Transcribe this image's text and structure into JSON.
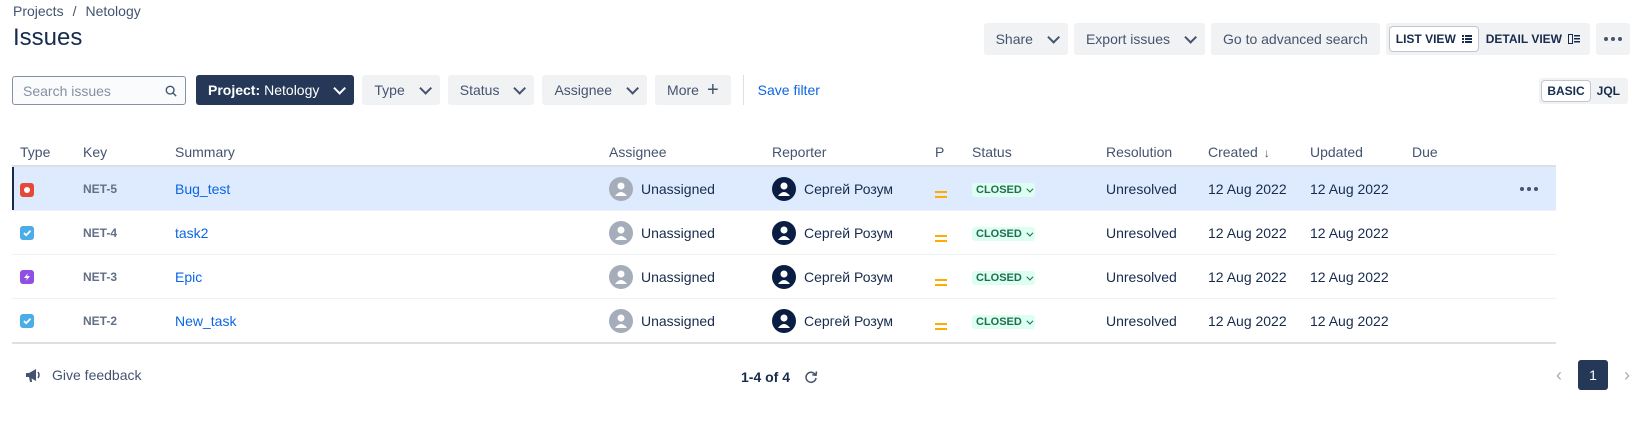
{
  "breadcrumb": {
    "projects": "Projects",
    "separator": "/",
    "project": "Netology"
  },
  "page_title": "Issues",
  "toolbar": {
    "share": "Share",
    "export": "Export issues",
    "advanced_search": "Go to advanced search",
    "list_view": "LIST VIEW",
    "detail_view": "DETAIL VIEW"
  },
  "search": {
    "placeholder": "Search issues"
  },
  "filters": {
    "project_label": "Project:",
    "project_value": "Netology",
    "type": "Type",
    "status": "Status",
    "assignee": "Assignee",
    "more": "More",
    "save_filter": "Save filter"
  },
  "mode": {
    "basic": "BASIC",
    "jql": "JQL"
  },
  "columns": {
    "type": "Type",
    "key": "Key",
    "summary": "Summary",
    "assignee": "Assignee",
    "reporter": "Reporter",
    "priority": "P",
    "status": "Status",
    "resolution": "Resolution",
    "created": "Created",
    "updated": "Updated",
    "due": "Due"
  },
  "rows": [
    {
      "type": "bug",
      "key": "NET-5",
      "summary": "Bug_test",
      "assignee": "Unassigned",
      "reporter": "Сергей Розум",
      "status": "CLOSED",
      "resolution": "Unresolved",
      "created": "12 Aug 2022",
      "updated": "12 Aug 2022",
      "due": ""
    },
    {
      "type": "task",
      "key": "NET-4",
      "summary": "task2",
      "assignee": "Unassigned",
      "reporter": "Сергей Розум",
      "status": "CLOSED",
      "resolution": "Unresolved",
      "created": "12 Aug 2022",
      "updated": "12 Aug 2022",
      "due": ""
    },
    {
      "type": "epic",
      "key": "NET-3",
      "summary": "Epic",
      "assignee": "Unassigned",
      "reporter": "Сергей Розум",
      "status": "CLOSED",
      "resolution": "Unresolved",
      "created": "12 Aug 2022",
      "updated": "12 Aug 2022",
      "due": ""
    },
    {
      "type": "task",
      "key": "NET-2",
      "summary": "New_task",
      "assignee": "Unassigned",
      "reporter": "Сергей Розум",
      "status": "CLOSED",
      "resolution": "Unresolved",
      "created": "12 Aug 2022",
      "updated": "12 Aug 2022",
      "due": ""
    }
  ],
  "footer": {
    "feedback": "Give feedback",
    "count": "1-4 of 4",
    "current_page": "1"
  },
  "colors": {
    "primary_dark": "#253858",
    "link": "#0C66E4",
    "selected_row": "#DEEBFF",
    "status_closed": "#216E4E"
  }
}
